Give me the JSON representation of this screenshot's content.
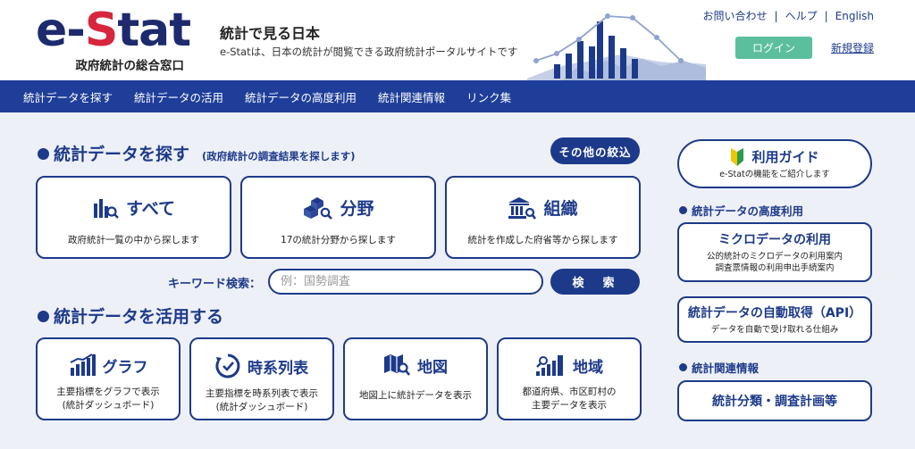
{
  "header": {
    "logo": {
      "e": "e-",
      "s": "S",
      "tat": "tat"
    },
    "logo_subtitle": "政府統計の総合窓口",
    "tagline_title": "統計で見る日本",
    "tagline_sub": "e-Statは、日本の統計が閲覧できる政府統計ポータルサイトです",
    "links": {
      "contact": "お問い合わせ",
      "help": "ヘルプ",
      "english": "English",
      "sep": "|"
    },
    "login": "ログイン",
    "register": "新規登録"
  },
  "nav": [
    "統計データを探す",
    "統計データの活用",
    "統計データの高度利用",
    "統計関連情報",
    "リンク集"
  ],
  "search_section": {
    "title": "統計データを探す",
    "note": "(政府統計の調査結果を探します)",
    "filter_button": "その他の絞込",
    "cards": [
      {
        "title": "すべて",
        "desc": "政府統計一覧の中から探します",
        "icon": "bar-search-icon"
      },
      {
        "title": "分野",
        "desc": "17の統計分野から探します",
        "icon": "blocks-search-icon"
      },
      {
        "title": "組織",
        "desc": "統計を作成した府省等から探します",
        "icon": "building-search-icon"
      }
    ],
    "keyword_label": "キーワード検索：",
    "keyword_placeholder": "例：国勢調査",
    "search_button": "検　索"
  },
  "use_section": {
    "title": "統計データを活用する",
    "cards": [
      {
        "title": "グラフ",
        "desc1": "主要指標をグラフで表示",
        "desc2": "(統計ダッシュボード)",
        "icon": "graph-icon"
      },
      {
        "title": "時系列表",
        "desc1": "主要指標を時系列表で表示",
        "desc2": "(統計ダッシュボード)",
        "icon": "clock-icon"
      },
      {
        "title": "地図",
        "desc1": "地図上に統計データを表示",
        "desc2": "",
        "icon": "map-search-icon"
      },
      {
        "title": "地域",
        "desc1": "都道府県、市区町村の",
        "desc2": "主要データを表示",
        "icon": "region-chart-icon"
      }
    ]
  },
  "sidebar": {
    "guide": {
      "title": "利用ガイド",
      "desc": "e-Statの機能をご紹介します"
    },
    "advanced_heading": "統計データの高度利用",
    "micro": {
      "title": "ミクロデータの利用",
      "desc1": "公的統計のミクロデータの利用案内",
      "desc2": "調査票情報の利用申出手続案内"
    },
    "api": {
      "title": "統計データの自動取得（API）",
      "desc": "データを自動で受け取れる仕組み"
    },
    "related_heading": "統計関連情報",
    "classification": {
      "title": "統計分類・調査計画等"
    }
  },
  "colors": {
    "brand_navy": "#1d3a8a",
    "nav_blue": "#1e3e9a",
    "login_green": "#5bbf9e",
    "accent_red": "#d7263d",
    "bg": "#edf0f7"
  }
}
